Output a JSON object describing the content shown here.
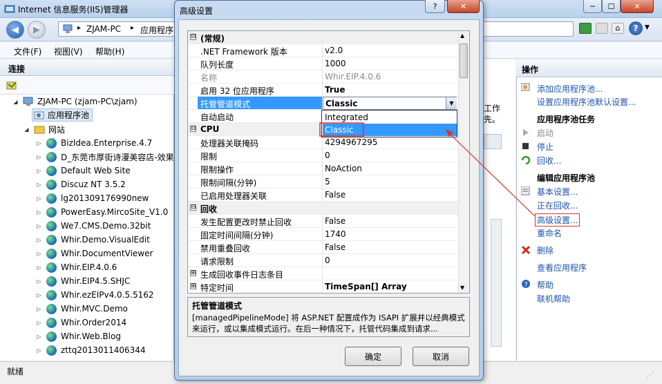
{
  "window": {
    "title": "Internet 信息服务(IIS)管理器",
    "minimize": "─",
    "maximize": "☐",
    "close": "✕"
  },
  "address": {
    "segments": [
      "ZJAM-PC",
      "应用程序"
    ]
  },
  "menu": {
    "file": "文件(F)",
    "view": "视图(V)",
    "help": "帮助(H)"
  },
  "connections": {
    "header": "连接",
    "server": "ZJAM-PC (zjam-PC\\zjam)",
    "app_pools": "应用程序池",
    "sites": "网站",
    "site_list": [
      "BizIdea.Enterprise.4.7",
      "D_东莞市厚街诗漫美容店-效果",
      "Default Web Site",
      "Discuz NT 3.5.2",
      "lg201309176990new",
      "PowerEasy.MircoSite_V1.0",
      "We7.CMS.Demo.32bit",
      "Whir.Demo.VisualEdit",
      "Whir.DocumentViewer",
      "Whir.EIP.4.0.6",
      "Whir.EIP4.5.SHJC",
      "Whir.ezEIPv4.0.5.5162",
      "Whir.MVC.Demo",
      "Whir.Order2014",
      "Whir.Web.Blog",
      "zttq2013011406344"
    ]
  },
  "center_fragments": {
    "a": "工作",
    "b": "先。"
  },
  "actions": {
    "header": "操作",
    "add_pool": "添加应用程序池...",
    "set_defaults": "设置应用程序池默认设置...",
    "tasks_header": "应用程序池任务",
    "start": "启动",
    "stop": "停止",
    "recycle": "回收...",
    "edit_header": "编辑应用程序池",
    "basic": "基本设置...",
    "recycling": "正在回收...",
    "advanced": "高级设置...",
    "rename": "重命名",
    "delete": "删除",
    "view_apps": "查看应用程序",
    "help": "帮助",
    "online_help": "联机帮助"
  },
  "status": {
    "text": "就绪"
  },
  "dialog": {
    "title": "高级设置",
    "help_btn": "?",
    "close_btn": "✕",
    "rows": [
      {
        "cat": true,
        "box": "⊟",
        "name": "(常规)"
      },
      {
        "name": ".NET Framework 版本",
        "value": "v2.0"
      },
      {
        "name": "队列长度",
        "value": "1000"
      },
      {
        "name": "名称",
        "value": "Whir.EIP.4.0.6",
        "dim": true
      },
      {
        "name": "启用 32 位应用程序",
        "value": "True",
        "bold": true
      },
      {
        "name": "托管管道模式",
        "value": "",
        "selected": true
      },
      {
        "name": "自动启动",
        "value": ""
      },
      {
        "cat": true,
        "box": "⊟",
        "name": "CPU"
      },
      {
        "name": "处理器关联掩码",
        "value": "4294967295"
      },
      {
        "name": "限制",
        "value": "0"
      },
      {
        "name": "限制操作",
        "value": "NoAction"
      },
      {
        "name": "限制间隔(分钟)",
        "value": "5"
      },
      {
        "name": "已启用处理器关联",
        "value": "False"
      },
      {
        "cat": true,
        "box": "⊟",
        "name": "回收"
      },
      {
        "name": "发生配置更改时禁止回收",
        "value": "False"
      },
      {
        "name": "固定时间间隔(分钟)",
        "value": "1740"
      },
      {
        "name": "禁用重叠回收",
        "value": "False"
      },
      {
        "name": "请求限制",
        "value": "0"
      },
      {
        "box": "⊞",
        "name": "生成回收事件日志条目",
        "value": ""
      },
      {
        "box": "⊞",
        "name": "特定时间",
        "value": "TimeSpan[] Array",
        "bold": true
      }
    ],
    "combo_value": "Classic",
    "dropdown_options": [
      "Integrated",
      "Classic"
    ],
    "desc_title": "托管管道模式",
    "desc_text": "[managedPipelineMode] 将 ASP.NET 配置成作为 ISAPI 扩展并以经典模式来运行，或以集成模式运行。在后一种情况下，托管代码集成到请求...",
    "ok": "确定",
    "cancel": "取消"
  },
  "colors": {
    "selection": "#3399ff",
    "annotation": "#e0302a",
    "link": "#1a56a8"
  }
}
